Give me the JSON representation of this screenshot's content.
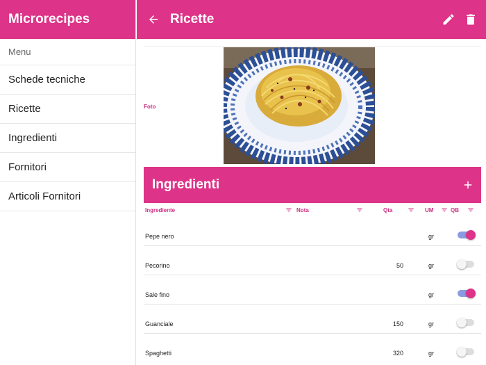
{
  "colors": {
    "primary": "#dd3388",
    "accent_text": "#cc2e80",
    "toggle_track_on": "#8a9be0"
  },
  "sidebar": {
    "title": "Microrecipes",
    "menu_label": "Menu",
    "items": [
      {
        "label": "Schede tecniche"
      },
      {
        "label": "Ricette"
      },
      {
        "label": "Ingredienti"
      },
      {
        "label": "Fornitori"
      },
      {
        "label": "Articoli Fornitori"
      }
    ]
  },
  "appbar": {
    "title": "Ricette",
    "icons": [
      "arrow-left-icon",
      "pencil-icon",
      "trash-icon"
    ]
  },
  "photo": {
    "label": "Foto",
    "description_icon": "spaghetti-carbonara-photo"
  },
  "ingredients": {
    "title": "Ingredienti",
    "add_icon": "plus-icon",
    "columns": {
      "ingrediente": "Ingrediente",
      "nota": "Nota",
      "qta": "Qta",
      "um": "UM",
      "qb": "QB"
    },
    "rows": [
      {
        "name": "Pepe nero",
        "qta": "",
        "um": "gr",
        "qb": true
      },
      {
        "name": "Pecorino",
        "qta": "50",
        "um": "gr",
        "qb": false
      },
      {
        "name": "Sale fino",
        "qta": "",
        "um": "gr",
        "qb": true
      },
      {
        "name": "Guanciale",
        "qta": "150",
        "um": "gr",
        "qb": false
      },
      {
        "name": "Spaghetti",
        "qta": "320",
        "um": "gr",
        "qb": false
      }
    ]
  }
}
